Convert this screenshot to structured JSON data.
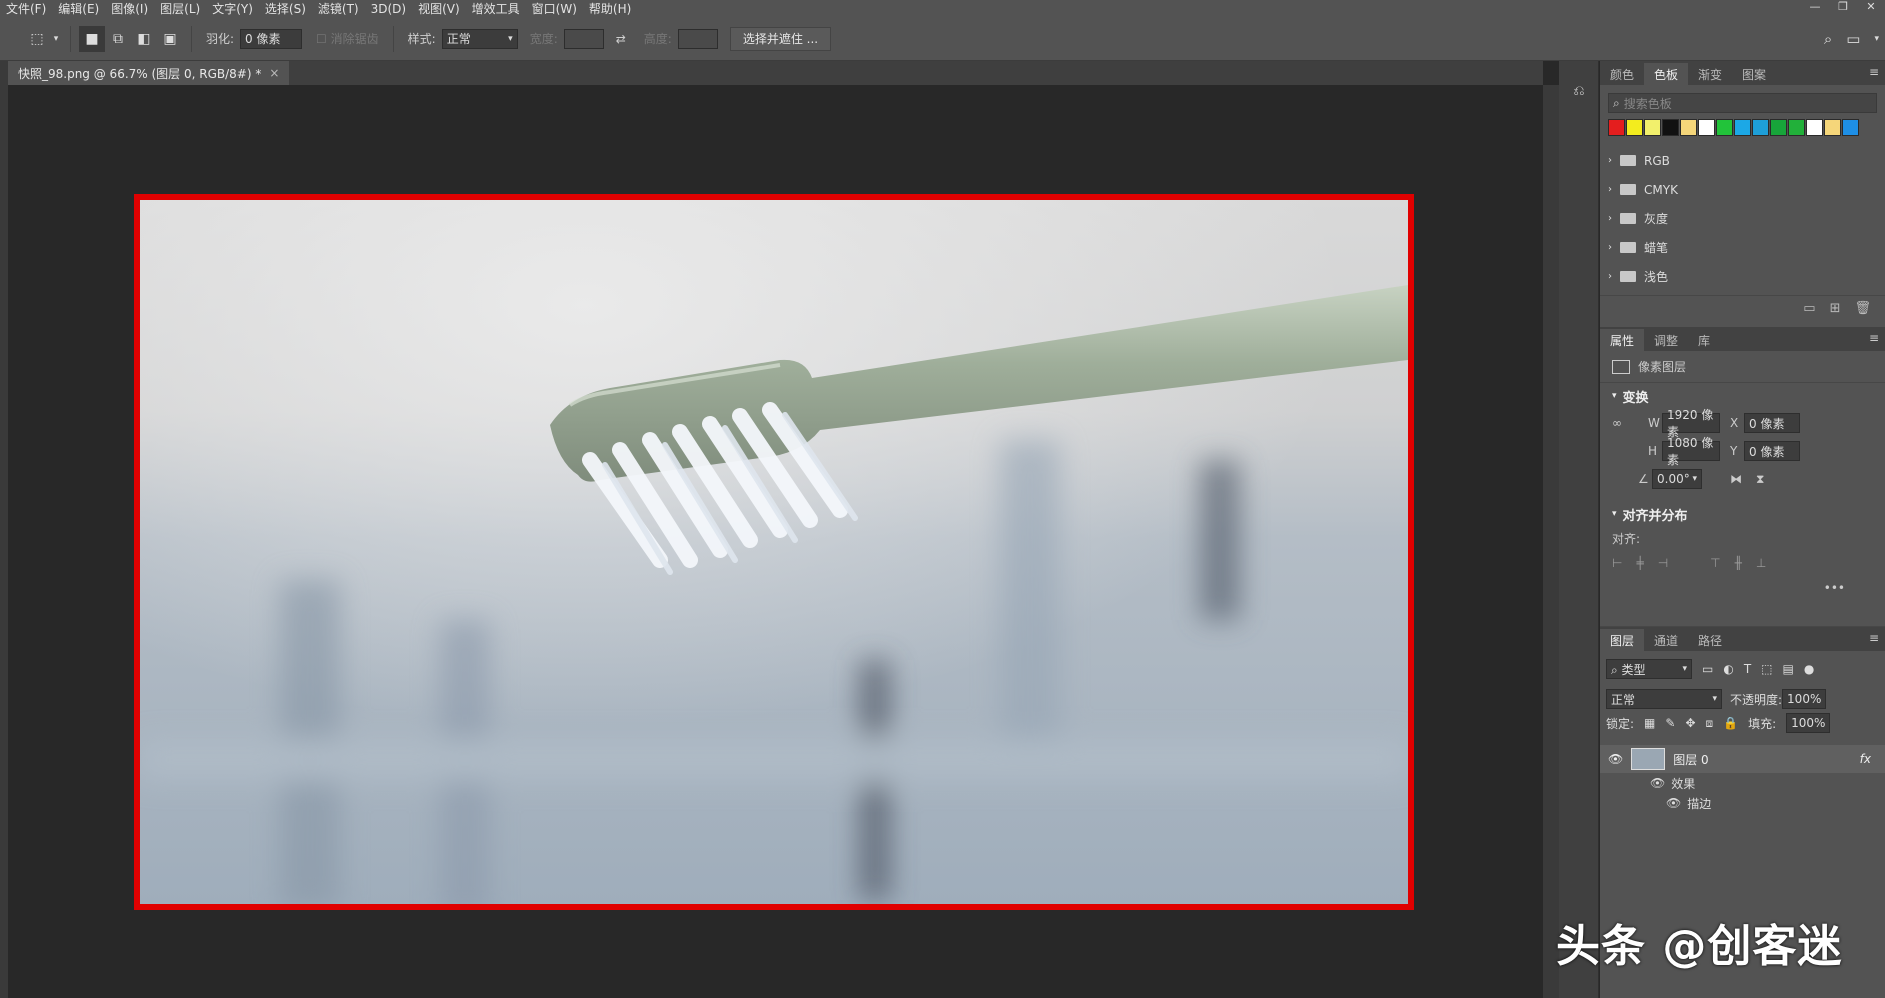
{
  "menu": [
    "文件(F)",
    "编辑(E)",
    "图像(I)",
    "图层(L)",
    "文字(Y)",
    "选择(S)",
    "滤镜(T)",
    "3D(D)",
    "视图(V)",
    "增效工具",
    "窗口(W)",
    "帮助(H)"
  ],
  "options": {
    "feather_label": "羽化:",
    "feather_value": "0 像素",
    "antialias_label": "消除锯齿",
    "style_label": "样式:",
    "style_value": "正常",
    "width_label": "宽度:",
    "height_label": "高度:",
    "select_mask_button": "选择并遮住 ..."
  },
  "document": {
    "tab_title": "快照_98.png @ 66.7% (图层 0, RGB/8#) *",
    "close": "×"
  },
  "swatches_panel": {
    "tabs": [
      "颜色",
      "色板",
      "渐变",
      "图案"
    ],
    "active_tab": "色板",
    "search_placeholder": "搜索色板",
    "colors": [
      "#e41e1e",
      "#f3ec1e",
      "#f2f06c",
      "#111111",
      "#f5d67a",
      "#ffffff",
      "#22c33a",
      "#1ca8e6",
      "#1e9fd8",
      "#17a53a",
      "#22b03a",
      "#ffffff",
      "#f5d67a",
      "#1e8fe6"
    ],
    "groups": [
      "RGB",
      "CMYK",
      "灰度",
      "蜡笔",
      "浅色"
    ]
  },
  "properties_panel": {
    "tabs": [
      "属性",
      "调整",
      "库"
    ],
    "active_tab": "属性",
    "layer_type": "像素图层",
    "transform_title": "变换",
    "w_label": "W",
    "w_value": "1920 像素",
    "x_label": "X",
    "x_value": "0 像素",
    "h_label": "H",
    "h_value": "1080 像素",
    "y_label": "Y",
    "y_value": "0 像素",
    "angle_value": "0.00°",
    "align_title": "对齐并分布",
    "align_label": "对齐:"
  },
  "layers_panel": {
    "tabs": [
      "图层",
      "通道",
      "路径"
    ],
    "active_tab": "图层",
    "filter_kind": "类型",
    "blend_mode": "正常",
    "opacity_label": "不透明度:",
    "opacity_value": "100%",
    "lock_label": "锁定:",
    "fill_label": "填充:",
    "fill_value": "100%",
    "layer_name": "图层 0",
    "fx": "fx",
    "effects_label": "效果",
    "stroke_label": "描边"
  },
  "watermark": "头条 @创客迷"
}
